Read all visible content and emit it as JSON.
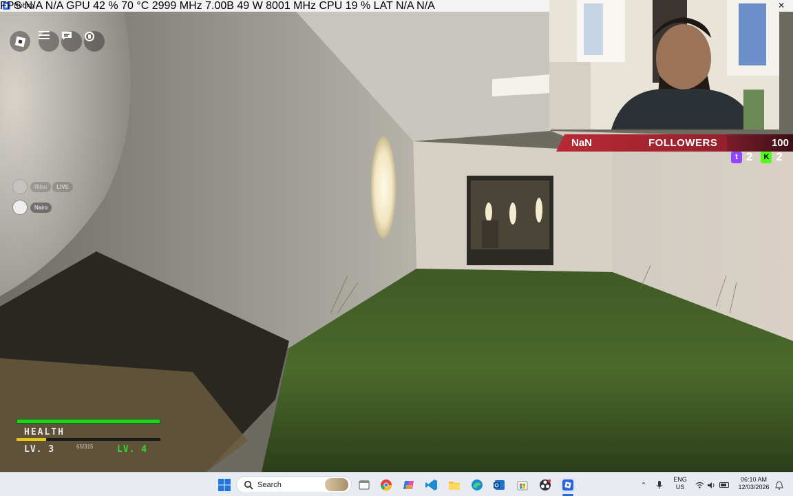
{
  "window": {
    "title": "Roblox",
    "close_symbol": "✕",
    "stats_overlay": "FPS  N/A  N/A     GPU  42 %  70 °C  2999 MHz  7.00B  49 W  8001 MHz     CPU  19 %     LAT  N/A  N/A"
  },
  "roblox_ui": {
    "buttons": [
      "roblox-logo",
      "menu",
      "chat",
      "headset"
    ]
  },
  "players": [
    {
      "name": "Ritsu",
      "badge": "LIVE",
      "dimmed": true
    },
    {
      "name": "Nairo",
      "badge": "",
      "dimmed": false
    }
  ],
  "hud": {
    "health_label": "HEALTH",
    "health_fraction": 1.0,
    "level_current": "LV. 3",
    "xp_text": "65/315",
    "xp_fraction": 0.2063,
    "level_next": "LV. 4"
  },
  "stream_overlay": {
    "name": "NaN",
    "followers_label": "FOLLOWERS",
    "followers_count": "100",
    "twitch_count": "2",
    "kick_count": "2",
    "colors": {
      "band": "#b82a35",
      "twitch": "#9146ff",
      "kick": "#53fc18"
    }
  },
  "taskbar": {
    "search_placeholder": "Search",
    "apps": [
      "windows-start",
      "search",
      "task-view",
      "chrome",
      "copilot",
      "vscode",
      "file-explorer",
      "edge",
      "outlook",
      "microsoft-store",
      "obs",
      "roblox"
    ],
    "language_line1": "ENG",
    "language_line2": "US",
    "time": "06:10 AM",
    "date": "12/03/2026"
  }
}
